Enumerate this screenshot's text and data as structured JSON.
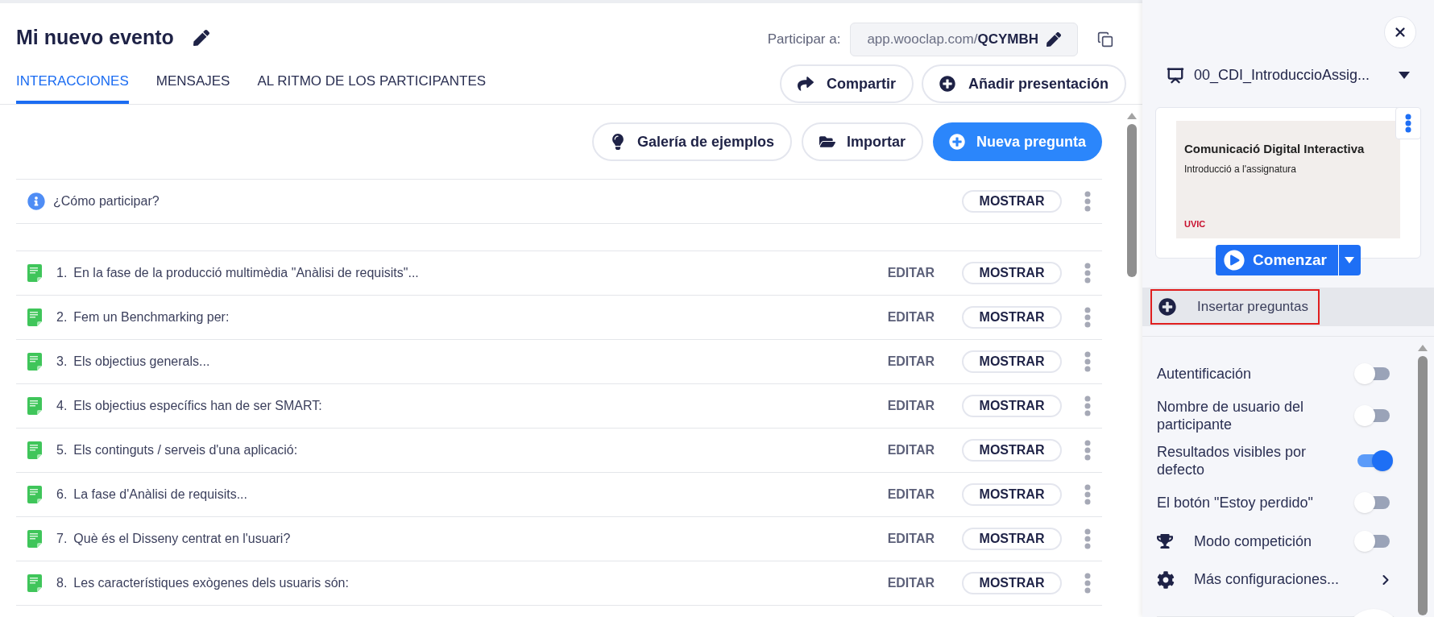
{
  "event": {
    "title": "Mi nuevo evento"
  },
  "participate": {
    "label": "Participar a:",
    "url_prefix": "app.wooclap.com/",
    "code": "QCYMBH"
  },
  "tabs": [
    {
      "label": "INTERACCIONES",
      "selected": true
    },
    {
      "label": "MENSAJES",
      "selected": false
    },
    {
      "label": "AL RITMO DE LOS PARTICIPANTES",
      "selected": false
    }
  ],
  "header_buttons": [
    {
      "label": "Compartir"
    },
    {
      "label": "Añadir presentación"
    }
  ],
  "toolbar": [
    {
      "label": "Galería de ejemplos",
      "kind": "outline"
    },
    {
      "label": "Importar",
      "kind": "outline"
    },
    {
      "label": "Nueva pregunta",
      "kind": "primary"
    }
  ],
  "info_row": {
    "text": "¿Cómo participar?",
    "action": "MOSTRAR"
  },
  "questions": [
    {
      "number": "1.",
      "text": "En la fase de la producció multimèdia \"Anàlisi de requisits\"...",
      "edit": "EDITAR",
      "show": "MOSTRAR"
    },
    {
      "number": "2.",
      "text": "Fem un Benchmarking per:",
      "edit": "EDITAR",
      "show": "MOSTRAR"
    },
    {
      "number": "3.",
      "text": "Els objectius generals...",
      "edit": "EDITAR",
      "show": "MOSTRAR"
    },
    {
      "number": "4.",
      "text": "Els objectius específics han de ser SMART:",
      "edit": "EDITAR",
      "show": "MOSTRAR"
    },
    {
      "number": "5.",
      "text": "Els continguts / serveis d'una aplicació:",
      "edit": "EDITAR",
      "show": "MOSTRAR"
    },
    {
      "number": "6.",
      "text": "La fase d'Anàlisi de requisits...",
      "edit": "EDITAR",
      "show": "MOSTRAR"
    },
    {
      "number": "7.",
      "text": "Què és el Disseny centrat en l'usuari?",
      "edit": "EDITAR",
      "show": "MOSTRAR"
    },
    {
      "number": "8.",
      "text": "Les característiques exògenes dels usuaris són:",
      "edit": "EDITAR",
      "show": "MOSTRAR"
    }
  ],
  "side_panel": {
    "presentation": "00_CDI_IntroduccioAssig...",
    "slide": {
      "title": "Comunicació Digital Interactiva",
      "subtitle": "Introducció a l'assignatura",
      "logo": "UVIC"
    },
    "start_button": "Comenzar",
    "insert": {
      "label": "Insertar preguntas",
      "highlighted": true
    },
    "settings": [
      {
        "label": "Autentificación",
        "on": false,
        "kind": "plain"
      },
      {
        "label": "Nombre de usuario del participante",
        "on": false,
        "kind": "plain"
      },
      {
        "label": "Resultados visibles por defecto",
        "on": true,
        "kind": "plain"
      },
      {
        "label": "El botón \"Estoy perdido\"",
        "on": false,
        "kind": "plain"
      },
      {
        "label": "Modo competición",
        "on": false,
        "kind": "trophy"
      }
    ],
    "more": "Más configuraciones..."
  }
}
